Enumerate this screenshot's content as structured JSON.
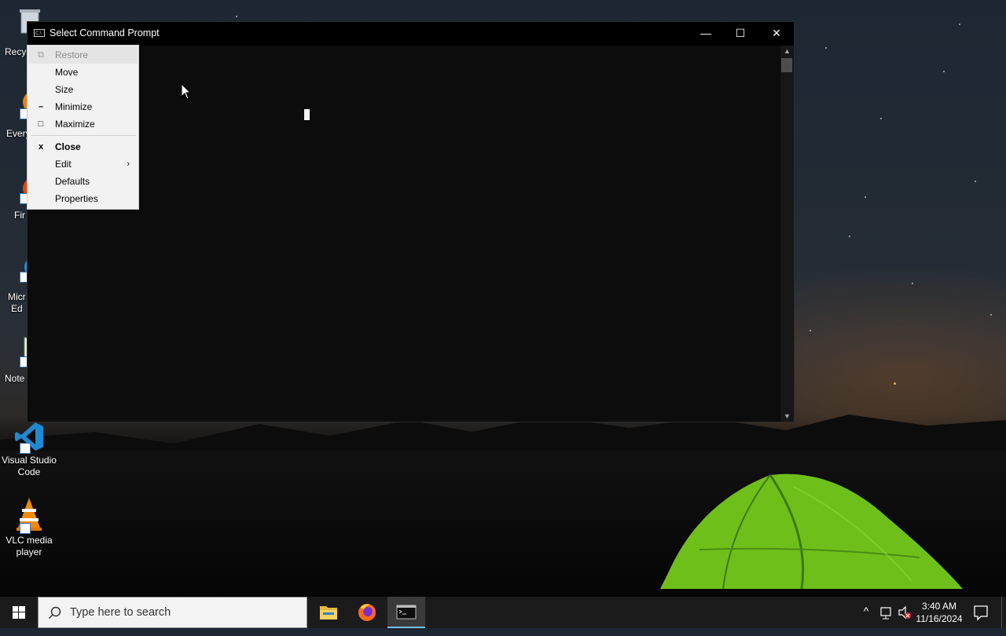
{
  "window": {
    "title": "Select Command Prompt",
    "buttons": {
      "minimize": "—",
      "maximize": "☐",
      "close": "✕"
    }
  },
  "system_menu": {
    "items": [
      {
        "label": "Restore",
        "mark": "⧉",
        "disabled": true,
        "highlighted": true
      },
      {
        "label": "Move"
      },
      {
        "label": "Size"
      },
      {
        "label": "Minimize",
        "mark": "–"
      },
      {
        "label": "Maximize",
        "mark": "□"
      },
      {
        "label": "Close",
        "mark": "x",
        "bold": true
      },
      {
        "label": "Edit",
        "submenu_arrow": "›"
      },
      {
        "label": "Defaults"
      },
      {
        "label": "Properties"
      }
    ]
  },
  "desktop": {
    "icons": [
      {
        "label": "Recy",
        "partial": true
      },
      {
        "label": "Every",
        "partial": true
      },
      {
        "label": "Fir",
        "partial": true
      },
      {
        "label": "Micr\nEd",
        "partial": true
      },
      {
        "label": "Note",
        "partial": true
      },
      {
        "label": "Visual Studio Code"
      },
      {
        "label": "VLC media player"
      }
    ]
  },
  "taskbar": {
    "search_placeholder": "Type here to search",
    "time": "3:40 AM",
    "date": "11/16/2024",
    "chevron": "^"
  },
  "colors": {
    "taskbar_bg": "#1b1b1b",
    "cmd_bg": "#0c0c0c",
    "menu_bg": "#f2f2f2",
    "active_underline": "#76b9ed"
  }
}
